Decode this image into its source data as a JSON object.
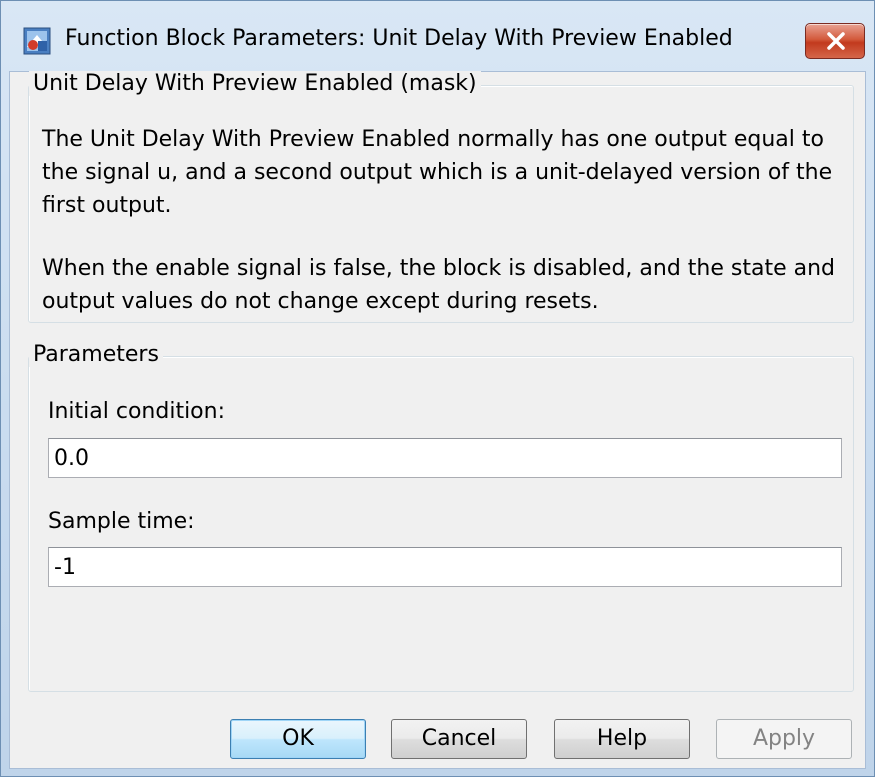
{
  "window": {
    "title": "Function Block Parameters: Unit Delay With Preview Enabled",
    "close_icon": "close-icon"
  },
  "description": {
    "group_title": "Unit Delay With Preview Enabled (mask)",
    "paragraph1": "The Unit Delay With Preview Enabled normally has one output equal to the signal u, and a second output which is a unit-delayed version of the first output.",
    "paragraph2": "When the enable signal is false, the block is disabled, and the state and output values do not change except during resets."
  },
  "parameters": {
    "group_title": "Parameters",
    "initial_condition": {
      "label": "Initial condition:",
      "value": "0.0"
    },
    "sample_time": {
      "label": "Sample time:",
      "value": "-1"
    }
  },
  "buttons": {
    "ok": "OK",
    "cancel": "Cancel",
    "help": "Help",
    "apply": "Apply"
  },
  "colors": {
    "close_button": "#c9452a",
    "default_button_border": "#3c7fb1",
    "disabled_text": "#838383"
  }
}
